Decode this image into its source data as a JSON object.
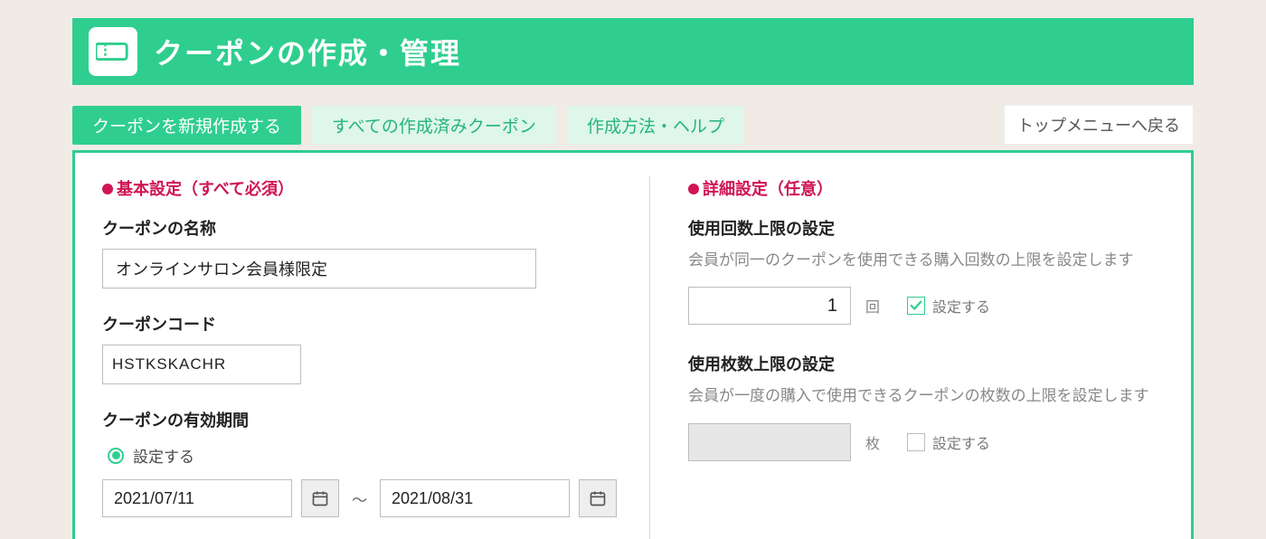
{
  "header": {
    "title": "クーポンの作成・管理"
  },
  "tabs": {
    "create": "クーポンを新規作成する",
    "all": "すべての作成済みクーポン",
    "help": "作成方法・ヘルプ",
    "back": "トップメニューへ戻る"
  },
  "basic": {
    "section_title": "基本設定（すべて必須）",
    "name_label": "クーポンの名称",
    "name_value": "オンラインサロン会員様限定",
    "code_label": "クーポンコード",
    "code_value": "HSTKSKACHR",
    "period_label": "クーポンの有効期間",
    "period_set": "設定する",
    "date_start": "2021/07/11",
    "date_end": "2021/08/31",
    "tilde": "～"
  },
  "adv": {
    "section_title": "詳細設定（任意）",
    "uses_label": "使用回数上限の設定",
    "uses_desc": "会員が同一のクーポンを使用できる購入回数の上限を設定します",
    "uses_value": "1",
    "uses_unit": "回",
    "uses_set": "設定する",
    "qty_label": "使用枚数上限の設定",
    "qty_desc": "会員が一度の購入で使用できるクーポンの枚数の上限を設定します",
    "qty_value": "",
    "qty_unit": "枚",
    "qty_set": "設定する"
  }
}
